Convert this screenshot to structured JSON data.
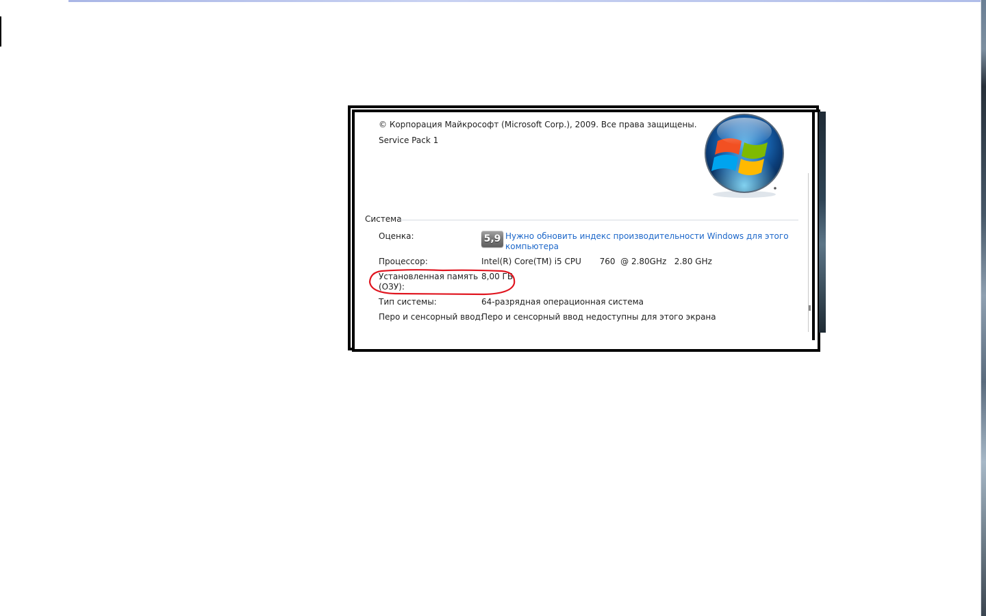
{
  "copyright": "© Корпорация Майкрософт (Microsoft Corp.), 2009. Все права защищены.",
  "service_pack": "Service Pack 1",
  "section": {
    "title": "Система"
  },
  "rating": {
    "label": "Оценка:",
    "score": "5,9",
    "link_line1": "Нужно обновить индекс производительности Windows для этого",
    "link_line2": "компьютера"
  },
  "processor": {
    "label": "Процессор:",
    "value": "Intel(R) Core(TM) i5 CPU       760  @ 2.80GHz   2.80 GHz"
  },
  "memory": {
    "label_line1": "Установленная память",
    "label_line2": "(ОЗУ):",
    "value": "8,00 ГБ",
    "highlight_color": "#e0141e"
  },
  "system_type": {
    "label": "Тип системы:",
    "value": "64-разрядная операционная система"
  },
  "pen_touch": {
    "label": "Перо и сенсорный ввод:",
    "value": "Перо и сенсорный ввод недоступны для этого экрана"
  },
  "icons": {
    "logo": "windows-logo-icon"
  }
}
